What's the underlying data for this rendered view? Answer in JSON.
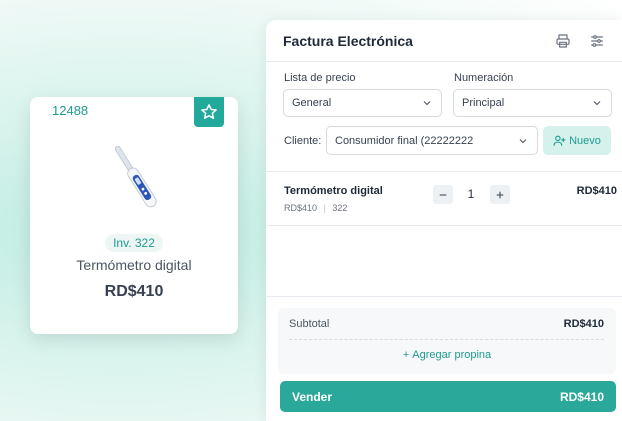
{
  "product_card": {
    "code": "12488",
    "inventory": "Inv. 322",
    "name": "Termómetro digital",
    "price": "RD$410"
  },
  "invoice": {
    "title": "Factura Electrónica",
    "price_list": {
      "label": "Lista de precio",
      "value": "General"
    },
    "numbering": {
      "label": "Numeración",
      "value": "Principal"
    },
    "client": {
      "label": "Cliente:",
      "value": "Consumidor final (22222222"
    },
    "new_button_label": "Nuevo",
    "items": [
      {
        "name": "Termómetro digital",
        "price_small": "RD$410",
        "stock": "322",
        "quantity": "1",
        "total": "RD$410"
      }
    ],
    "subtotal_label": "Subtotal",
    "subtotal_value": "RD$410",
    "tip_label": "Agregar propina",
    "sell_label": "Vender",
    "sell_total": "RD$410"
  },
  "colors": {
    "accent": "#2aa89a",
    "accent_light": "#d4f1ec"
  },
  "icons": [
    "star-icon",
    "print-icon",
    "settings-sliders-icon",
    "chevron-down-icon",
    "add-user-icon",
    "minus-icon",
    "plus-icon"
  ]
}
